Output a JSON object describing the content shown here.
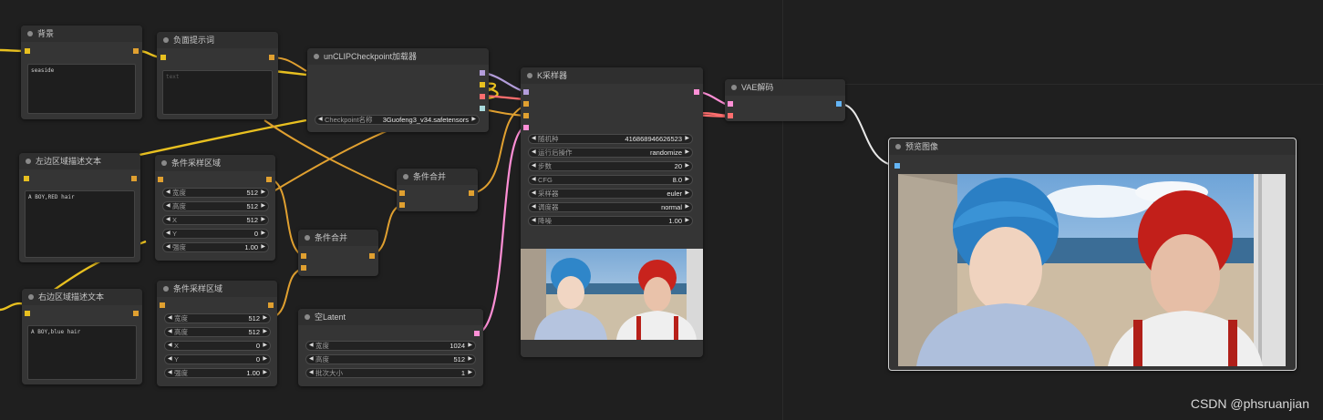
{
  "nodes": {
    "bg": {
      "title": "背景",
      "text": "seaside"
    },
    "neg": {
      "title": "负面提示词",
      "placeholder": "text"
    },
    "ckpt": {
      "title": "unCLIPCheckpoint加载器",
      "widget_label": "Checkpoint名称",
      "widget_value": "3Guofeng3_v34.safetensors"
    },
    "ksampler": {
      "title": "K采样器",
      "widgets": [
        {
          "label": "随机种",
          "value": "416868946626523"
        },
        {
          "label": "运行后操作",
          "value": "randomize"
        },
        {
          "label": "步数",
          "value": "20"
        },
        {
          "label": "CFG",
          "value": "8.0"
        },
        {
          "label": "采样器",
          "value": "euler"
        },
        {
          "label": "调度器",
          "value": "normal"
        },
        {
          "label": "降噪",
          "value": "1.00"
        }
      ]
    },
    "vae": {
      "title": "VAE解码"
    },
    "preview": {
      "title": "预览图像"
    },
    "left_text": {
      "title": "左边区域描述文本",
      "text": "A BOY,RED hair"
    },
    "right_text": {
      "title": "右边区域描述文本",
      "text": "A BOY,blue hair"
    },
    "area1": {
      "title": "条件采样区域",
      "widgets": [
        {
          "label": "宽度",
          "value": "512"
        },
        {
          "label": "高度",
          "value": "512"
        },
        {
          "label": "X",
          "value": "512"
        },
        {
          "label": "Y",
          "value": "0"
        },
        {
          "label": "强度",
          "value": "1.00"
        }
      ]
    },
    "area2": {
      "title": "条件采样区域",
      "widgets": [
        {
          "label": "宽度",
          "value": "512"
        },
        {
          "label": "高度",
          "value": "512"
        },
        {
          "label": "X",
          "value": "0"
        },
        {
          "label": "Y",
          "value": "0"
        },
        {
          "label": "强度",
          "value": "1.00"
        }
      ]
    },
    "combine1": {
      "title": "条件合并"
    },
    "combine2": {
      "title": "条件合并"
    },
    "latent": {
      "title": "空Latent",
      "widgets": [
        {
          "label": "宽度",
          "value": "1024"
        },
        {
          "label": "高度",
          "value": "512"
        },
        {
          "label": "批次大小",
          "value": "1"
        }
      ]
    }
  },
  "watermark": "CSDN @phsruanjian",
  "colors": {
    "conditioning": "#e0a030",
    "clip": "#e8c020",
    "model": "#b39ddb",
    "latent": "#ff8fd6",
    "vae": "#ff6e6e",
    "image": "#64b5f6",
    "clip_vision": "#a8dadc"
  }
}
